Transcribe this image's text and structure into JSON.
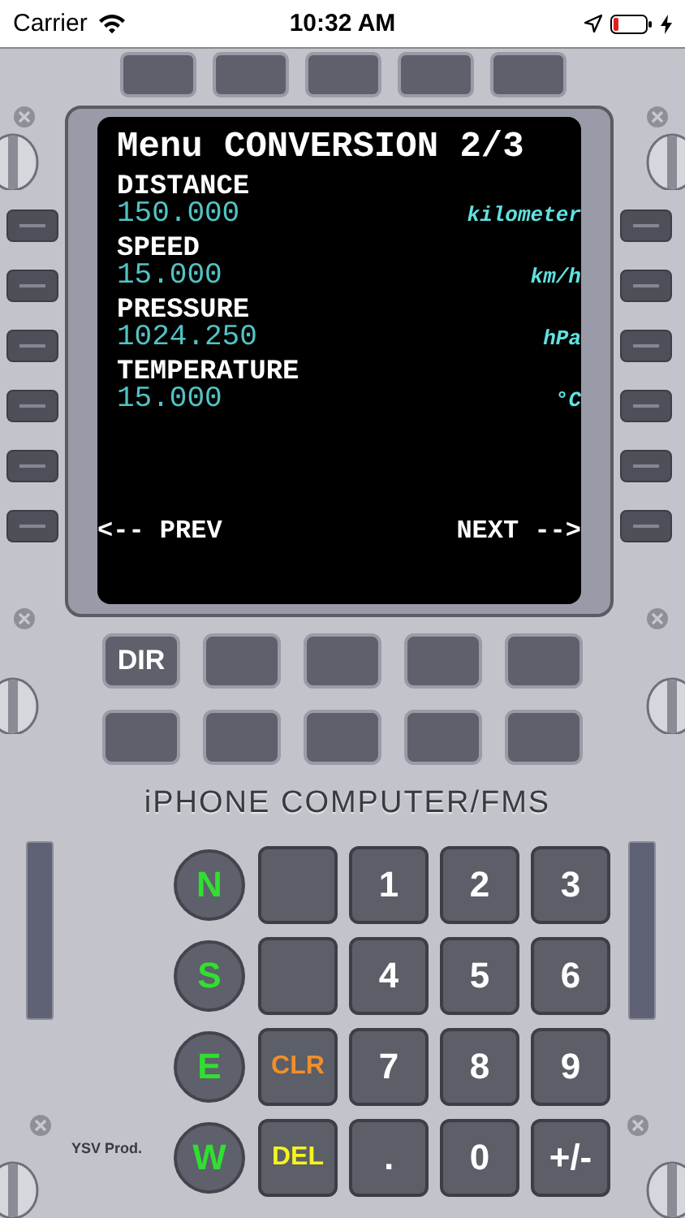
{
  "status_bar": {
    "carrier": "Carrier",
    "time": "10:32 AM"
  },
  "top_keys": [
    {
      "kind": "blank"
    },
    {
      "kind": "blank"
    },
    {
      "kind": "blank"
    },
    {
      "kind": "blank"
    },
    {
      "kind": "blank"
    }
  ],
  "screen": {
    "title": "Menu CONVERSION 2/3",
    "rows": [
      {
        "label": "DISTANCE",
        "value": "150.000",
        "unit": "kilometer"
      },
      {
        "label": "SPEED",
        "value": "15.000",
        "unit": "km/h"
      },
      {
        "label": "PRESSURE",
        "value": "1024.250",
        "unit": "hPa"
      },
      {
        "label": "TEMPERATURE",
        "value": "15.000",
        "unit": "°C"
      }
    ],
    "prev": "<-- PREV",
    "next": "NEXT -->"
  },
  "function_keys": [
    {
      "kind": "label",
      "label": "DIR"
    },
    {
      "kind": "blank"
    },
    {
      "kind": "blank"
    },
    {
      "kind": "blank"
    },
    {
      "kind": "blank"
    },
    {
      "kind": "blank"
    },
    {
      "kind": "blank"
    },
    {
      "kind": "blank"
    },
    {
      "kind": "blank"
    },
    {
      "kind": "blank"
    }
  ],
  "brand": "iPHONE COMPUTER/FMS",
  "credit": "YSV Prod.",
  "direction_keys": [
    "N",
    "S",
    "E",
    "W"
  ],
  "keypad": [
    {
      "kind": "blank"
    },
    {
      "kind": "digit",
      "label": "1"
    },
    {
      "kind": "digit",
      "label": "2"
    },
    {
      "kind": "digit",
      "label": "3"
    },
    {
      "kind": "blank"
    },
    {
      "kind": "digit",
      "label": "4"
    },
    {
      "kind": "digit",
      "label": "5"
    },
    {
      "kind": "digit",
      "label": "6"
    },
    {
      "kind": "clear",
      "label": "CLR"
    },
    {
      "kind": "digit",
      "label": "7"
    },
    {
      "kind": "digit",
      "label": "8"
    },
    {
      "kind": "digit",
      "label": "9"
    },
    {
      "kind": "delete",
      "label": "DEL"
    },
    {
      "kind": "digit",
      "label": "."
    },
    {
      "kind": "digit",
      "label": "0"
    },
    {
      "kind": "digit",
      "label": "+/-"
    }
  ]
}
